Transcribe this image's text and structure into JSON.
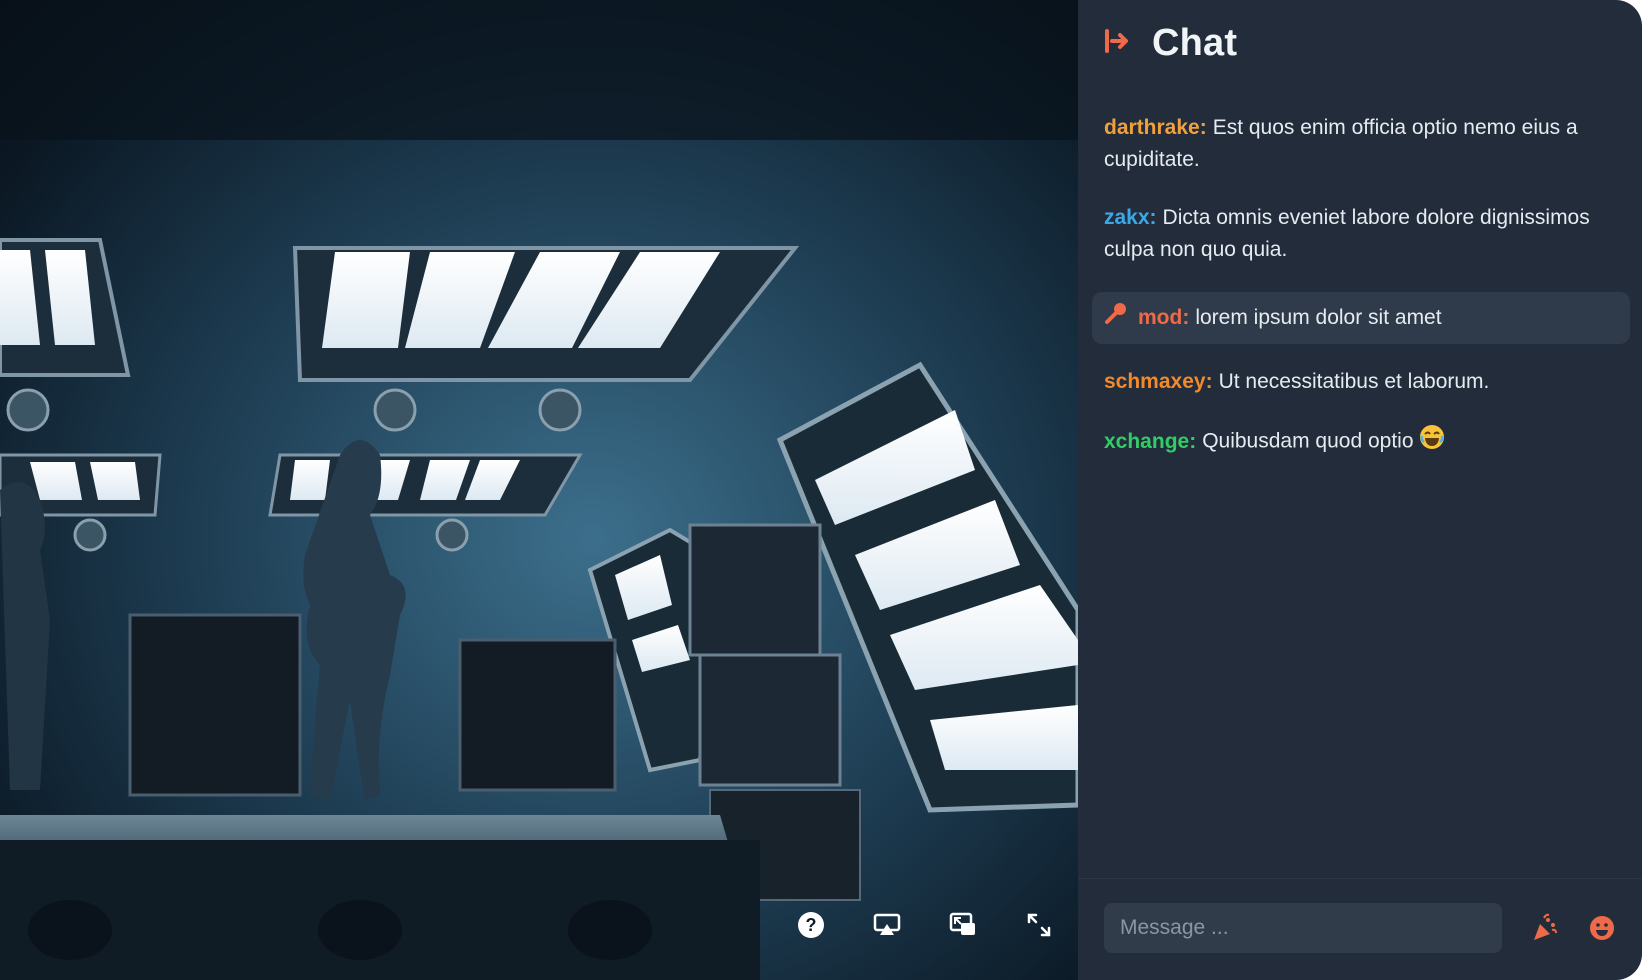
{
  "video": {
    "controls": [
      {
        "icon": "help-icon"
      },
      {
        "icon": "airplay-icon"
      },
      {
        "icon": "picture-in-picture-icon"
      },
      {
        "icon": "fullscreen-icon"
      }
    ]
  },
  "chat": {
    "header_icon": "exit-arrow-icon",
    "title": "Chat",
    "messages": [
      {
        "user": "darthrake:",
        "text": "Est quos enim officia optio nemo eius a cupiditate.",
        "color": "#f0a03c"
      },
      {
        "user": "zakx:",
        "text": "Dicta omnis eveniet labore dolore dignissimos culpa non quo quia.",
        "color": "#3aa9e8"
      },
      {
        "user": "mod:",
        "text": "lorem ipsum dolor sit amet",
        "color": "#ee6a48",
        "badge_icon": "wrench-icon"
      },
      {
        "user": "schmaxey:",
        "text": "Ut necessitatibus et laborum.",
        "color": "#f08a2c"
      },
      {
        "user": "xchange:",
        "text": "Quibusdam quod optio",
        "color": "#33cc66",
        "emoji": "laughing-face-emoji"
      }
    ],
    "composer": {
      "placeholder": "Message ...",
      "buttons": [
        {
          "icon": "party-popper-icon"
        },
        {
          "icon": "emoji-face-icon"
        }
      ]
    }
  },
  "colors": {
    "accent": "#ee6a48",
    "panel_background": "#222c3a",
    "highlight_background": "#2f3b4b"
  }
}
